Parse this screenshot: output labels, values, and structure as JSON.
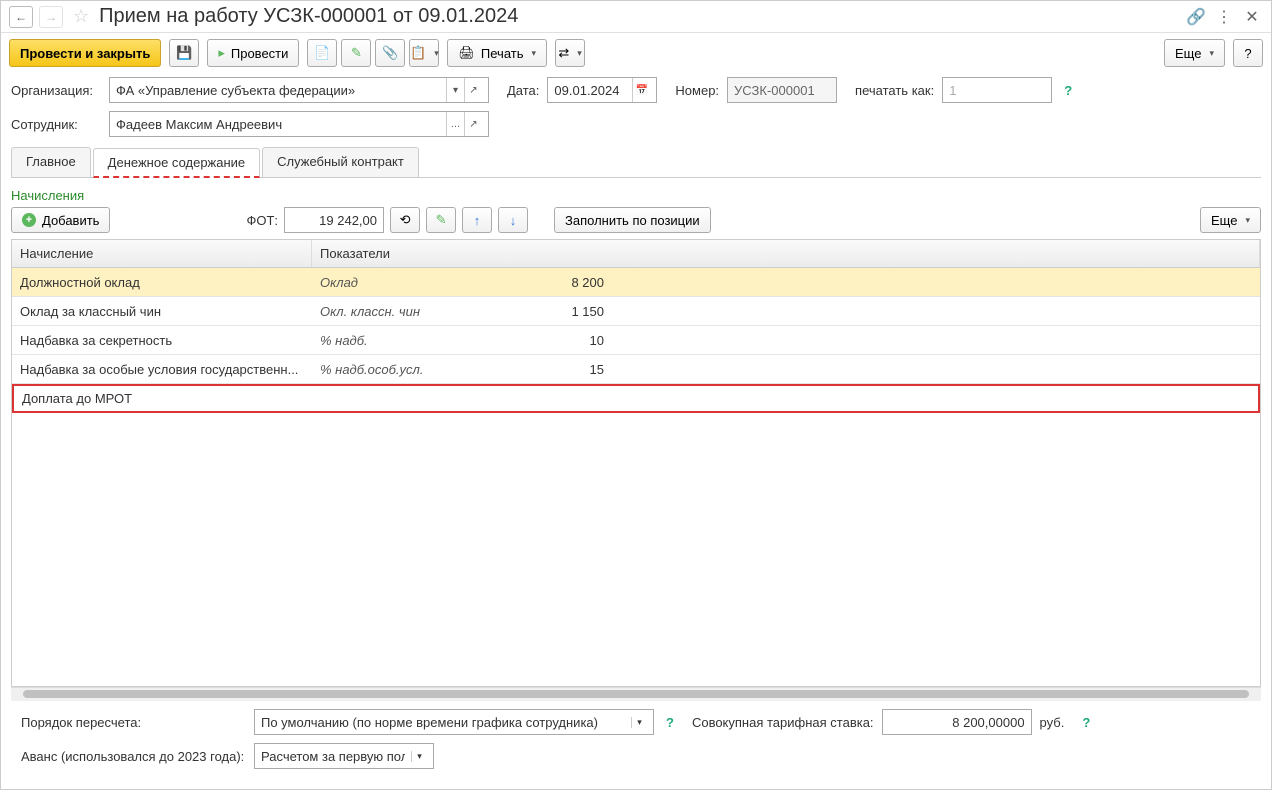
{
  "title": "Прием на работу УСЗК-000001 от 09.01.2024",
  "toolbar": {
    "primary": "Провести и закрыть",
    "post": "Провести",
    "print": "Печать",
    "more": "Еще"
  },
  "form": {
    "org_label": "Организация:",
    "org_value": "ФА «Управление субъекта федерации»",
    "emp_label": "Сотрудник:",
    "emp_value": "Фадеев Максим Андреевич",
    "date_label": "Дата:",
    "date_value": "09.01.2024",
    "num_label": "Номер:",
    "num_value": "УСЗК-000001",
    "print_as_label": "печатать как:",
    "print_as_value": "1"
  },
  "tabs": [
    "Главное",
    "Денежное содержание",
    "Служебный контракт"
  ],
  "section": {
    "title": "Начисления",
    "add": "Добавить",
    "fot_label": "ФОТ:",
    "fot_value": "19 242,00",
    "fill_by_pos": "Заполнить по позиции",
    "more": "Еще"
  },
  "table": {
    "headers": [
      "Начисление",
      "Показатели"
    ],
    "rows": [
      {
        "name": "Должностной оклад",
        "indicator": "Оклад",
        "value": "8 200",
        "selected": true
      },
      {
        "name": "Оклад за классный чин",
        "indicator": "Окл. классн. чин",
        "value": "1 150"
      },
      {
        "name": "Надбавка за секретность",
        "indicator": "% надб.",
        "value": "10"
      },
      {
        "name": "Надбавка за особые условия государственн...",
        "indicator": "% надб.особ.усл.",
        "value": "15"
      },
      {
        "name": "Доплата до МРОТ",
        "indicator": "",
        "value": "",
        "highlight": true
      }
    ]
  },
  "footer": {
    "recalc_label": "Порядок пересчета:",
    "recalc_value": "По умолчанию (по норме времени графика сотрудника)",
    "rate_label": "Совокупная тарифная ставка:",
    "rate_value": "8 200,00000",
    "rate_unit": "руб.",
    "advance_label": "Аванс (использовался до 2023 года):",
    "advance_value": "Расчетом за первую поло"
  },
  "help": "?"
}
